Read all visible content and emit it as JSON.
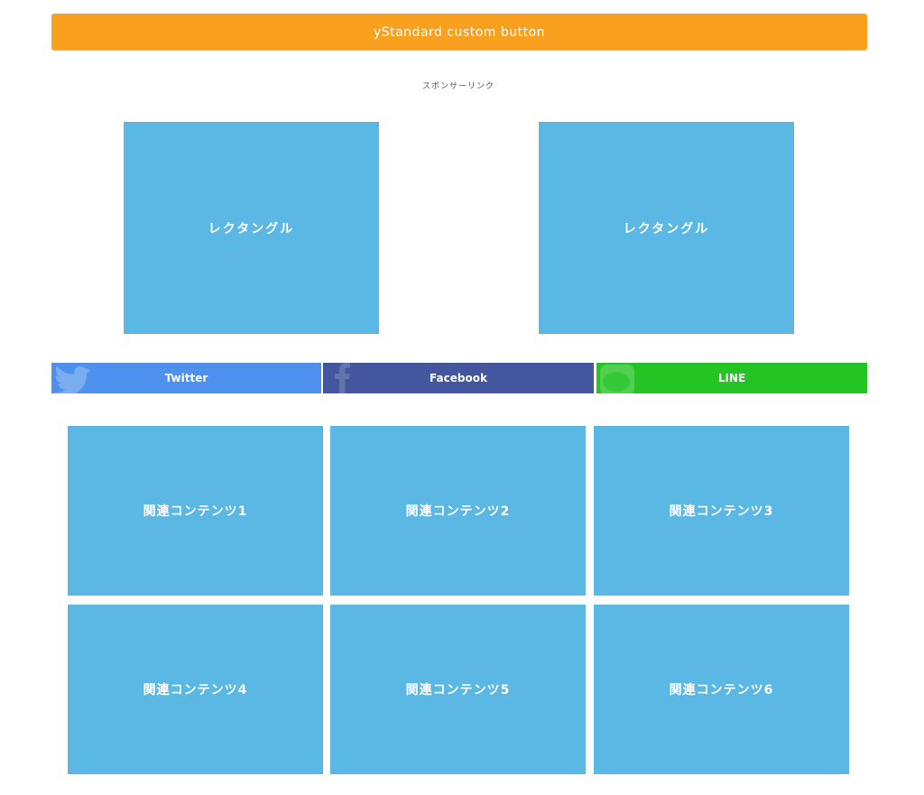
{
  "custom_button": {
    "label": "yStandard custom button",
    "color": "#F9A11E"
  },
  "sponsor": {
    "label": "スポンサーリンク",
    "ads": [
      {
        "label": "レクタングル"
      },
      {
        "label": "レクタングル"
      }
    ],
    "ad_color": "#5BB7E3"
  },
  "share": {
    "buttons": [
      {
        "label": "Twitter",
        "icon": "twitter-bird-icon",
        "color": "#4E90ED"
      },
      {
        "label": "Facebook",
        "icon": "facebook-f-icon",
        "color": "#43569E"
      },
      {
        "label": "LINE",
        "icon": "line-logo-icon",
        "color": "#25C425"
      }
    ]
  },
  "related": {
    "items": [
      {
        "label": "関連コンテンツ1"
      },
      {
        "label": "関連コンテンツ2"
      },
      {
        "label": "関連コンテンツ3"
      },
      {
        "label": "関連コンテンツ4"
      },
      {
        "label": "関連コンテンツ5"
      },
      {
        "label": "関連コンテンツ6"
      }
    ],
    "color": "#5BB7E3"
  }
}
